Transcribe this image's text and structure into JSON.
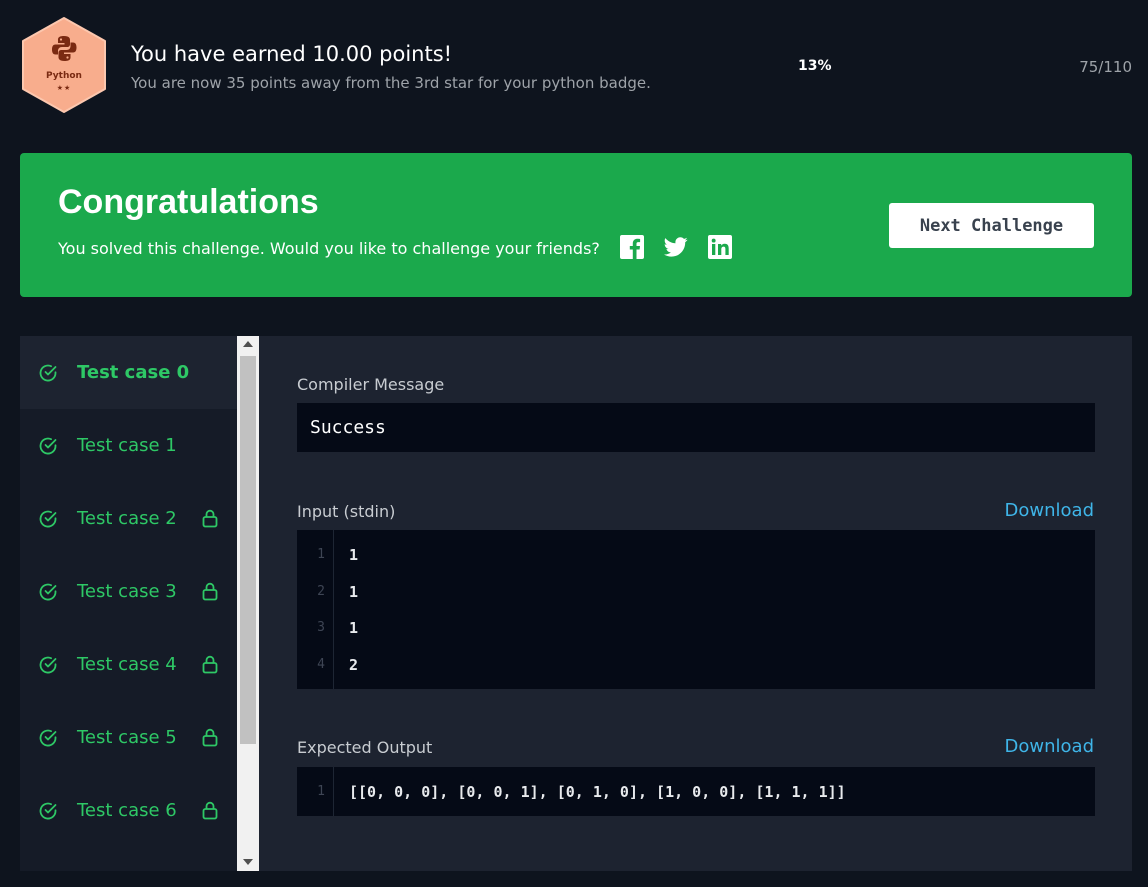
{
  "header": {
    "badge_label": "Python",
    "badge_stars": "★★",
    "title": "You have earned 10.00 points!",
    "subtitle": "You are now 35 points away from the 3rd star for your python badge.",
    "progress_percent": "13%",
    "progress_count": "75/110"
  },
  "banner": {
    "title": "Congratulations",
    "text": "You solved this challenge. Would you like to challenge your friends?",
    "next_button": "Next Challenge",
    "color": "#1ba94c"
  },
  "test_cases": [
    {
      "label": "Test case 0",
      "locked": false,
      "active": true
    },
    {
      "label": "Test case 1",
      "locked": false,
      "active": false
    },
    {
      "label": "Test case 2",
      "locked": true,
      "active": false
    },
    {
      "label": "Test case 3",
      "locked": true,
      "active": false
    },
    {
      "label": "Test case 4",
      "locked": true,
      "active": false
    },
    {
      "label": "Test case 5",
      "locked": true,
      "active": false
    },
    {
      "label": "Test case 6",
      "locked": true,
      "active": false
    }
  ],
  "compiler": {
    "label": "Compiler Message",
    "message": "Success"
  },
  "input": {
    "label": "Input (stdin)",
    "download": "Download",
    "lines": [
      {
        "num": "1",
        "text": "1"
      },
      {
        "num": "2",
        "text": "1"
      },
      {
        "num": "3",
        "text": "1"
      },
      {
        "num": "4",
        "text": "2"
      }
    ]
  },
  "expected": {
    "label": "Expected Output",
    "download": "Download",
    "lines": [
      {
        "num": "1",
        "text": "[[0, 0, 0], [0, 0, 1], [0, 1, 0], [1, 0, 0], [1, 1, 1]]"
      }
    ]
  }
}
